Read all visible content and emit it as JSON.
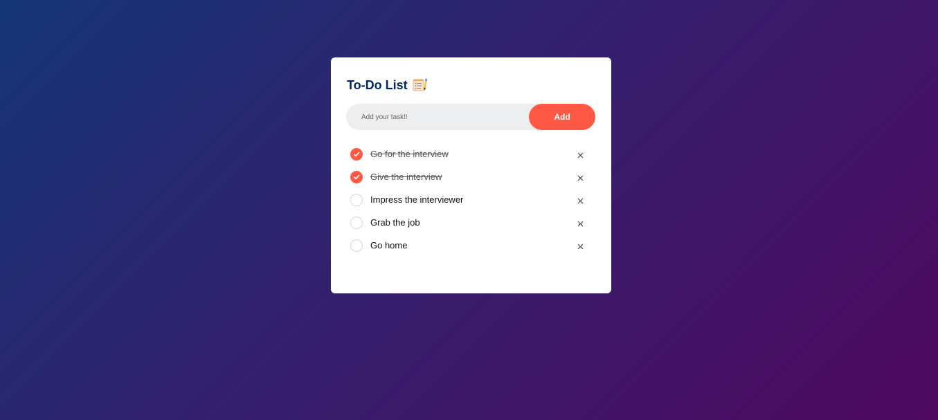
{
  "app": {
    "title": "To-Do List"
  },
  "input": {
    "placeholder": "Add your task!!",
    "value": ""
  },
  "add_button": {
    "label": "Add"
  },
  "tasks": [
    {
      "label": "Go for the interview",
      "done": true
    },
    {
      "label": "Give the interview",
      "done": true
    },
    {
      "label": "Impress the interviewer",
      "done": false
    },
    {
      "label": "Grab the job",
      "done": false
    },
    {
      "label": "Go home",
      "done": false
    }
  ],
  "colors": {
    "accent": "#ff5945",
    "title": "#002765",
    "input_bg": "#edeef0",
    "bg_start": "#153677",
    "bg_end": "#4e085f"
  },
  "icons": {
    "title_icon": "notepad-icon",
    "check_icon": "checkmark-icon",
    "delete_icon": "close-icon"
  }
}
